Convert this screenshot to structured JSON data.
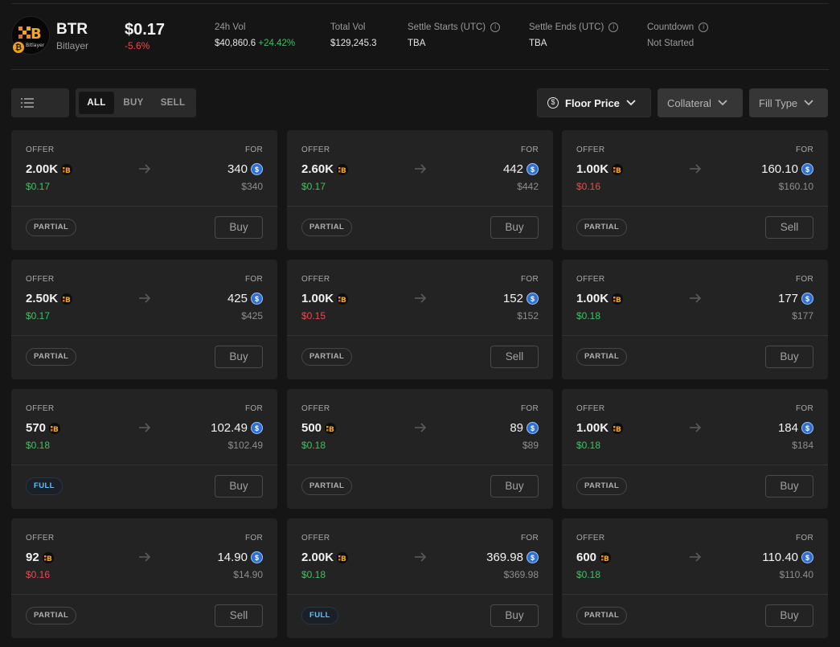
{
  "token": {
    "symbol": "BTR",
    "name": "Bitlayer",
    "logo_word": "Bitlayer",
    "price": "$0.17",
    "change": "-5.6%"
  },
  "stats": {
    "vol24h": {
      "label": "24h Vol",
      "value": "$40,860.6",
      "change": "+24.42%"
    },
    "total_vol": {
      "label": "Total Vol",
      "value": "$129,245.3"
    },
    "settle_start": {
      "label": "Settle Starts (UTC)",
      "value": "TBA"
    },
    "settle_end": {
      "label": "Settle Ends (UTC)",
      "value": "TBA"
    },
    "countdown": {
      "label": "Countdown",
      "value": "Not Started"
    }
  },
  "toolbar": {
    "side_all": "ALL",
    "side_buy": "BUY",
    "side_sell": "SELL",
    "sort_label": "Floor Price",
    "collateral_label": "Collateral",
    "filltype_label": "Fill Type"
  },
  "labels": {
    "offer": "OFFER",
    "for": "FOR"
  },
  "colors": {
    "green": "#3ec25f",
    "red": "#f04848",
    "accent_blue": "#5cc2ff"
  },
  "cards": [
    {
      "offer": "2.00K",
      "unit_price": "$0.17",
      "price_dir": "up",
      "for": "340",
      "for_usd": "$340",
      "fill": "PARTIAL",
      "action": "Buy"
    },
    {
      "offer": "2.60K",
      "unit_price": "$0.17",
      "price_dir": "up",
      "for": "442",
      "for_usd": "$442",
      "fill": "PARTIAL",
      "action": "Buy"
    },
    {
      "offer": "1.00K",
      "unit_price": "$0.16",
      "price_dir": "down",
      "for": "160.10",
      "for_usd": "$160.10",
      "fill": "PARTIAL",
      "action": "Sell"
    },
    {
      "offer": "2.50K",
      "unit_price": "$0.17",
      "price_dir": "up",
      "for": "425",
      "for_usd": "$425",
      "fill": "PARTIAL",
      "action": "Buy"
    },
    {
      "offer": "1.00K",
      "unit_price": "$0.15",
      "price_dir": "down",
      "for": "152",
      "for_usd": "$152",
      "fill": "PARTIAL",
      "action": "Sell"
    },
    {
      "offer": "1.00K",
      "unit_price": "$0.18",
      "price_dir": "up",
      "for": "177",
      "for_usd": "$177",
      "fill": "PARTIAL",
      "action": "Buy"
    },
    {
      "offer": "570",
      "unit_price": "$0.18",
      "price_dir": "up",
      "for": "102.49",
      "for_usd": "$102.49",
      "fill": "FULL",
      "action": "Buy"
    },
    {
      "offer": "500",
      "unit_price": "$0.18",
      "price_dir": "up",
      "for": "89",
      "for_usd": "$89",
      "fill": "PARTIAL",
      "action": "Buy"
    },
    {
      "offer": "1.00K",
      "unit_price": "$0.18",
      "price_dir": "up",
      "for": "184",
      "for_usd": "$184",
      "fill": "PARTIAL",
      "action": "Buy"
    },
    {
      "offer": "92",
      "unit_price": "$0.16",
      "price_dir": "down",
      "for": "14.90",
      "for_usd": "$14.90",
      "fill": "PARTIAL",
      "action": "Sell"
    },
    {
      "offer": "2.00K",
      "unit_price": "$0.18",
      "price_dir": "up",
      "for": "369.98",
      "for_usd": "$369.98",
      "fill": "FULL",
      "action": "Buy"
    },
    {
      "offer": "600",
      "unit_price": "$0.18",
      "price_dir": "up",
      "for": "110.40",
      "for_usd": "$110.40",
      "fill": "PARTIAL",
      "action": "Buy"
    }
  ]
}
